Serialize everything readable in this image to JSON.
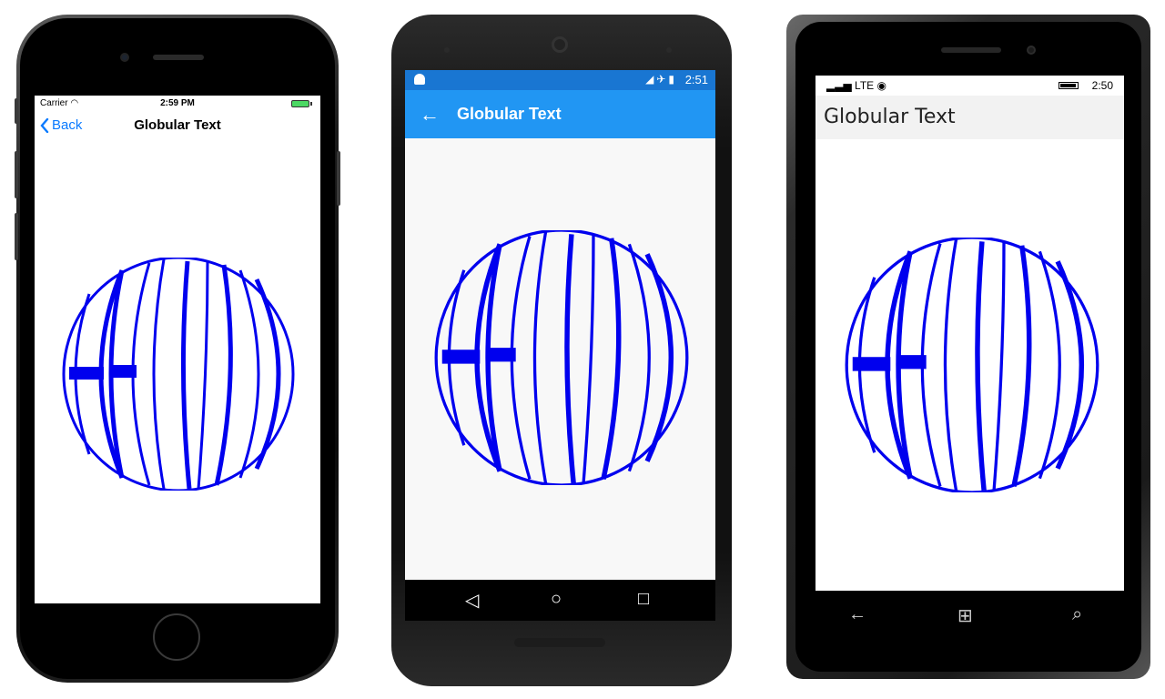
{
  "ios": {
    "carrier": "Carrier",
    "time": "2:59 PM",
    "back_label": "Back",
    "title": "Globular Text"
  },
  "android": {
    "time": "2:51",
    "title": "Globular Text"
  },
  "winphone": {
    "network": "LTE",
    "time": "2:50",
    "title": "Globular Text"
  },
  "globe": {
    "text": "HELLO",
    "color": "#0000ee"
  },
  "colors": {
    "ios_accent": "#0a7aff",
    "android_status": "#1976d2",
    "android_appbar": "#2196f3"
  }
}
